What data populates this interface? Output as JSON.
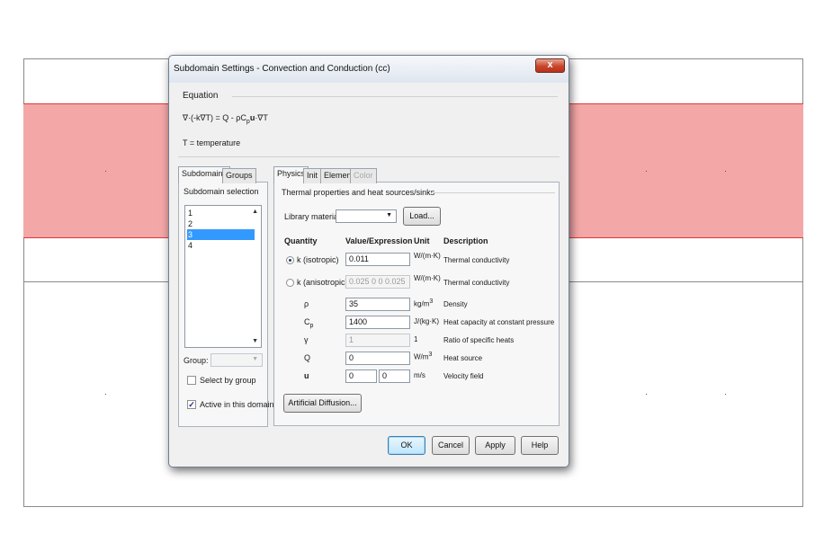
{
  "dialog": {
    "title": "Subdomain Settings - Convection and Conduction (cc)",
    "close_label": "x"
  },
  "equation": {
    "heading": "Equation",
    "formula": {
      "part1": "∇·(-k∇T) = Q - ρC",
      "sub_p": "p",
      "bold_u": "u",
      "part2": "·∇T"
    },
    "note": "T = temperature"
  },
  "left_tabs": [
    "Subdomains",
    "Groups"
  ],
  "subdomain_selection": {
    "heading": "Subdomain selection",
    "items": [
      "1",
      "2",
      "3",
      "4"
    ],
    "selected_index": 2
  },
  "group": {
    "label": "Group:",
    "select_by_group": "Select by group",
    "active_in_domain": "Active in this domain"
  },
  "right_tabs": [
    "Physics",
    "Init",
    "Element",
    "Color"
  ],
  "physics": {
    "section_heading": "Thermal properties and heat sources/sinks",
    "library_label": "Library material:",
    "load_button": "Load...",
    "columns": {
      "quantity": "Quantity",
      "value": "Value/Expression",
      "unit": "Unit",
      "description": "Description"
    },
    "rows": {
      "k_iso": {
        "label": "k (isotropic)",
        "value": "0.011",
        "unit": "W/(m·K)",
        "desc": "Thermal conductivity"
      },
      "k_aniso": {
        "label": "k (anisotropic)",
        "value": "0.025 0 0 0.025",
        "unit": "W/(m·K)",
        "desc": "Thermal conductivity"
      },
      "rho": {
        "label": "ρ",
        "value": "35",
        "unit_base": "kg/m",
        "unit_sup": "3",
        "desc": "Density"
      },
      "cp": {
        "label_base": "C",
        "label_sub": "p",
        "value": "1400",
        "unit": "J/(kg·K)",
        "desc": "Heat capacity at constant pressure"
      },
      "gamma": {
        "label": "γ",
        "value": "1",
        "unit": "1",
        "desc": "Ratio of specific heats"
      },
      "q": {
        "label": "Q",
        "value": "0",
        "unit_base": "W/m",
        "unit_sup": "3",
        "desc": "Heat source"
      },
      "u": {
        "label": "u",
        "value_x": "0",
        "value_y": "0",
        "unit": "m/s",
        "desc": "Velocity field"
      }
    },
    "artificial_diffusion_button": "Artificial Diffusion..."
  },
  "footer": {
    "ok": "OK",
    "cancel": "Cancel",
    "apply": "Apply",
    "help": "Help"
  }
}
